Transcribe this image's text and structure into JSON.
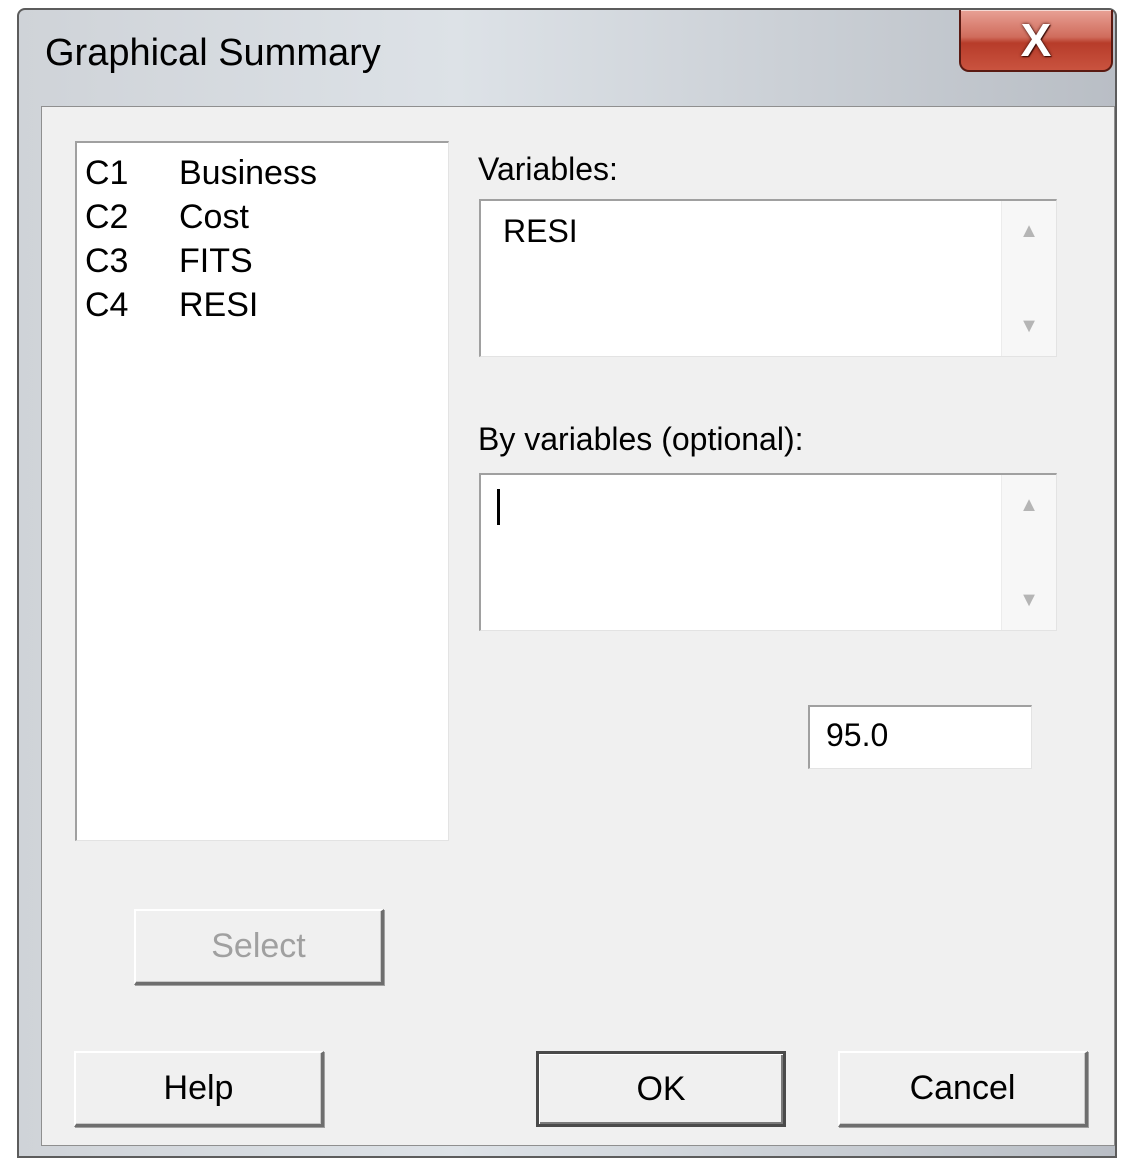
{
  "window": {
    "title": "Graphical Summary",
    "close_glyph": "X"
  },
  "columns_list": {
    "items": [
      {
        "id": "C1",
        "name": "Business"
      },
      {
        "id": "C2",
        "name": "Cost"
      },
      {
        "id": "C3",
        "name": "FITS"
      },
      {
        "id": "C4",
        "name": "RESI"
      }
    ]
  },
  "variables": {
    "label": "Variables:",
    "value": "RESI"
  },
  "by_variables": {
    "label": "By variables (optional):",
    "value": ""
  },
  "confidence_field": {
    "value": "95.0"
  },
  "buttons": {
    "select": "Select",
    "help": "Help",
    "ok": "OK",
    "cancel": "Cancel"
  },
  "icons": {
    "scroll_up": "▲",
    "scroll_down": "▼"
  }
}
